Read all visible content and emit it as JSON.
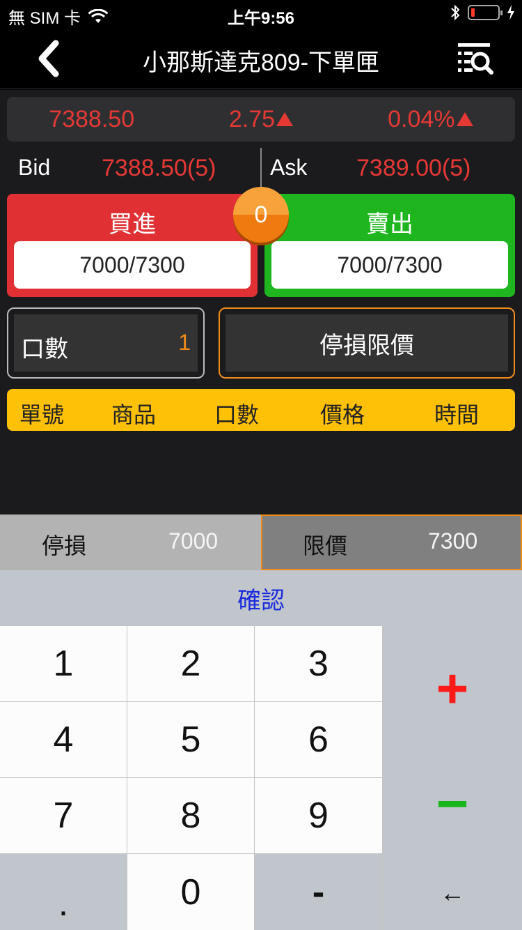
{
  "status": {
    "carrier": "無 SIM 卡",
    "time": "上午9:56"
  },
  "nav": {
    "title": "小那斯達克809-下單匣"
  },
  "quote": {
    "last": "7388.50",
    "change": "2.75",
    "change_pct": "0.04%",
    "color": "#e53935"
  },
  "bidask": {
    "bid_label": "Bid",
    "bid_value": "7388.50(5)",
    "ask_label": "Ask",
    "ask_value": "7389.00(5)"
  },
  "trade": {
    "buy_label": "買進",
    "buy_price": "7000/7300",
    "sell_label": "賣出",
    "sell_price": "7000/7300",
    "position": "0"
  },
  "qty": {
    "label": "口數",
    "value": "1"
  },
  "order_type": {
    "label": "停損限價"
  },
  "order_table": {
    "headers": [
      "單號",
      "商品",
      "口數",
      "價格",
      "時間"
    ]
  },
  "pricebar": {
    "stop_label": "停損",
    "stop_value": "7000",
    "limit_label": "限價",
    "limit_value": "7300"
  },
  "keypad": {
    "confirm": "確認",
    "keys": [
      "1",
      "2",
      "3",
      "4",
      "5",
      "6",
      "7",
      "8",
      "9",
      ".",
      "0",
      "-"
    ],
    "plus": "+",
    "minus": "−",
    "backspace": "←"
  }
}
